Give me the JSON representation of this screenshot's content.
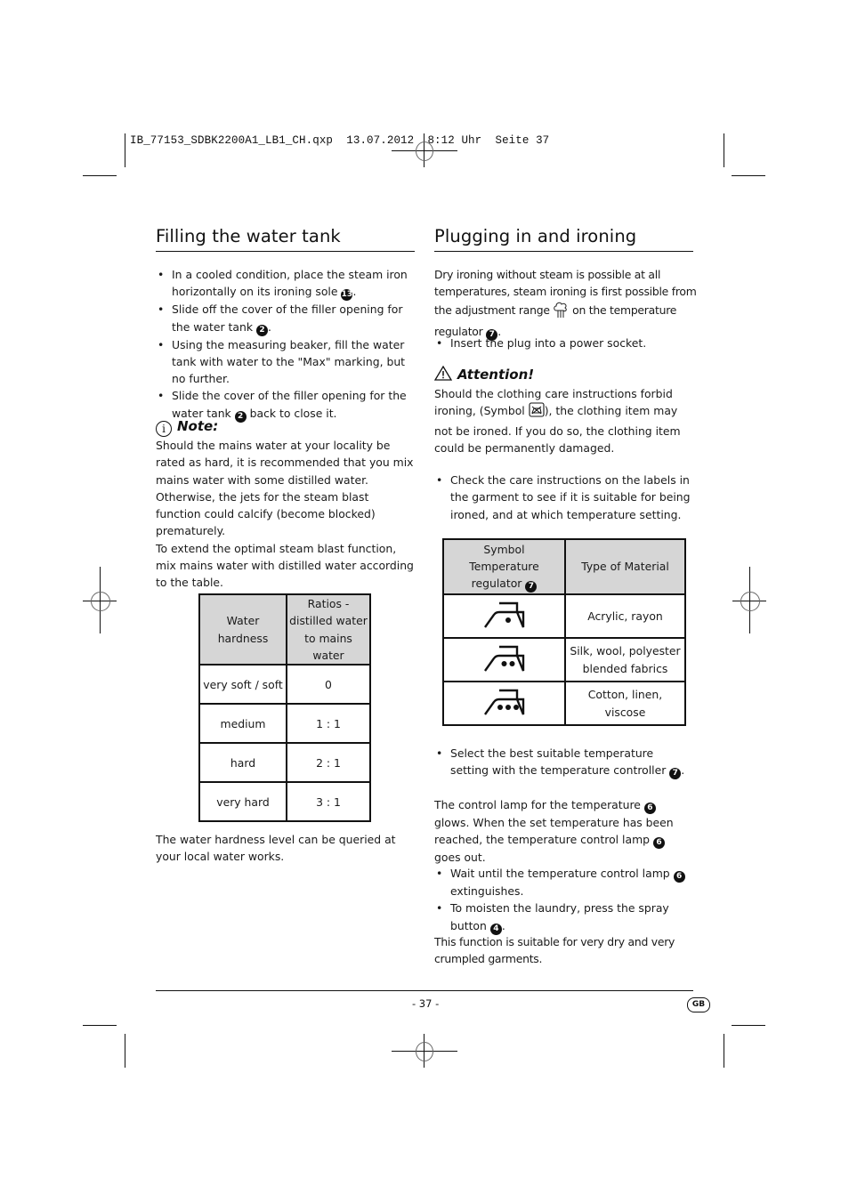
{
  "slug": {
    "text": "IB_77153_SDBK2200A1_LB1_CH.qxp  13.07.2012  8:12 Uhr  Seite 37"
  },
  "left": {
    "title": "Filling the water tank",
    "bullets": [
      {
        "text": "In a cooled condition, place the steam iron horizontally on its ironing sole",
        "ref": "13",
        "suffix": "."
      },
      {
        "text": "Slide off the cover of the filler opening for the water tank",
        "ref": "2",
        "suffix": "."
      },
      {
        "text": "Using the measuring beaker, fill the water tank with water to the \"Max\" marking, but no further.",
        "ref": "",
        "suffix": ""
      },
      {
        "text_before": "Slide the cover of the filler opening for the water tank",
        "ref": "2",
        "text_after": "back to close it."
      }
    ],
    "note": {
      "icon": "info-icon",
      "title": "Note:",
      "paragraph1": "Should the mains water at your locality be rated as hard, it is recommended that you mix mains water with some distilled water. Otherwise, the jets for the steam blast function could calcify (become blocked) prematurely.",
      "paragraph2": "To extend the optimal steam blast function, mix mains water with distilled water according to the table."
    },
    "hardness_table": {
      "headers": [
        "Water hardness",
        "Ratios - distilled water to mains water"
      ],
      "rows": [
        [
          "very soft / soft",
          "0"
        ],
        [
          "medium",
          "1 : 1"
        ],
        [
          "hard",
          "2 : 1"
        ],
        [
          "very hard",
          "3 : 1"
        ]
      ]
    },
    "footer_text": "The water hardness level can be queried at your local water works."
  },
  "right": {
    "title": "Plugging in and ironing",
    "intro_part1": "Dry ironing without steam is possible at all temperatures, steam ironing is first possible from the adjustment range",
    "intro_icon": "steam-icon",
    "intro_part2": "on the temperature regulator",
    "intro_ref": "7",
    "bullet_plug": "Insert the plug into a power socket.",
    "attention": {
      "icon": "warning-icon",
      "title": "Attention!",
      "text_before": "Should the clothing care instructions forbid ironing, (Symbol",
      "symbol_icon": "do-not-iron-icon",
      "text_after": "), the clothing item may not be ironed. If you do so, the clothing item could be permanently damaged."
    },
    "bullet_check": "Check the care instructions on the labels in the garment to see if it is suitable for being ironed, and at which temperature setting.",
    "material_table": {
      "headers": [
        "Symbol Temperature regulator",
        "Type of Material"
      ],
      "header_ref": "7",
      "rows": [
        {
          "dots": 1,
          "icon": "iron-one-dot-icon",
          "material": "Acrylic, rayon"
        },
        {
          "dots": 2,
          "icon": "iron-two-dots-icon",
          "material": "Silk, wool, polyester blended fabrics"
        },
        {
          "dots": 3,
          "icon": "iron-three-dots-icon",
          "material": "Cotton, linen, viscose"
        }
      ]
    },
    "bullet_select": {
      "text": "Select the best suitable temperature setting with the temperature controller",
      "ref": "7"
    },
    "lamp_para": {
      "part1": "The control lamp for the temperature",
      "ref1": "6",
      "part2": "glows. When the set temperature has been reached, the temperature control lamp",
      "ref2": "6",
      "part3": "goes out."
    },
    "bullets_final": [
      {
        "text_before": "Wait until the temperature control lamp",
        "ref": "6",
        "text_after": "extinguishes."
      },
      {
        "text_before": "To moisten the laundry, press the spray button",
        "ref": "4",
        "text_after": "."
      }
    ],
    "closing": "This function is suitable for very dry and very crumpled garments."
  },
  "footer": {
    "page_number": "- 37 -",
    "language_badge": "GB"
  }
}
